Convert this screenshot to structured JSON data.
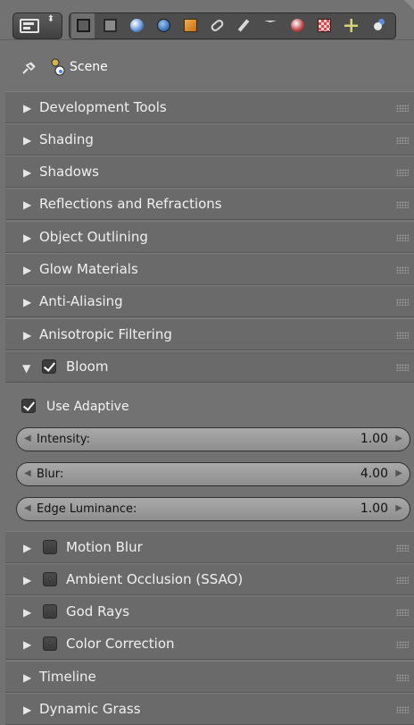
{
  "toolbar": {
    "editor_icon": "properties-editor-icon",
    "context_tabs": [
      {
        "icon": "render-icon",
        "active": true
      },
      {
        "icon": "render-layers-icon",
        "active": false
      },
      {
        "icon": "scene-icon",
        "active": false
      },
      {
        "icon": "world-icon",
        "active": false
      },
      {
        "icon": "object-icon",
        "active": false
      },
      {
        "icon": "constraints-icon",
        "active": false
      },
      {
        "icon": "modifiers-icon",
        "active": false
      },
      {
        "icon": "object-data-icon",
        "active": false
      },
      {
        "icon": "material-icon",
        "active": false
      },
      {
        "icon": "texture-icon",
        "active": false
      },
      {
        "icon": "particles-icon",
        "active": false
      },
      {
        "icon": "physics-icon",
        "active": false
      }
    ]
  },
  "scene": {
    "label": "Scene"
  },
  "panels_top": [
    "Development Tools",
    "Shading",
    "Shadows",
    "Reflections and Refractions",
    "Object Outlining",
    "Glow Materials",
    "Anti-Aliasing",
    "Anisotropic Filtering"
  ],
  "bloom": {
    "label": "Bloom",
    "enabled": true,
    "use_adaptive": {
      "label": "Use Adaptive",
      "checked": true
    },
    "sliders": [
      {
        "label": "Intensity:",
        "value": "1.00"
      },
      {
        "label": "Blur:",
        "value": "4.00"
      },
      {
        "label": "Edge Luminance:",
        "value": "1.00"
      }
    ]
  },
  "panels_checkbox": [
    {
      "label": "Motion Blur",
      "checked": false
    },
    {
      "label": "Ambient Occlusion (SSAO)",
      "checked": false
    },
    {
      "label": "God Rays",
      "checked": false
    },
    {
      "label": "Color Correction",
      "checked": false
    }
  ],
  "panels_bottom": [
    "Timeline",
    "Dynamic Grass"
  ],
  "colors": {
    "background": "#727272",
    "panel_header": "#6a6a6a",
    "slider": "#9b9b9b"
  }
}
